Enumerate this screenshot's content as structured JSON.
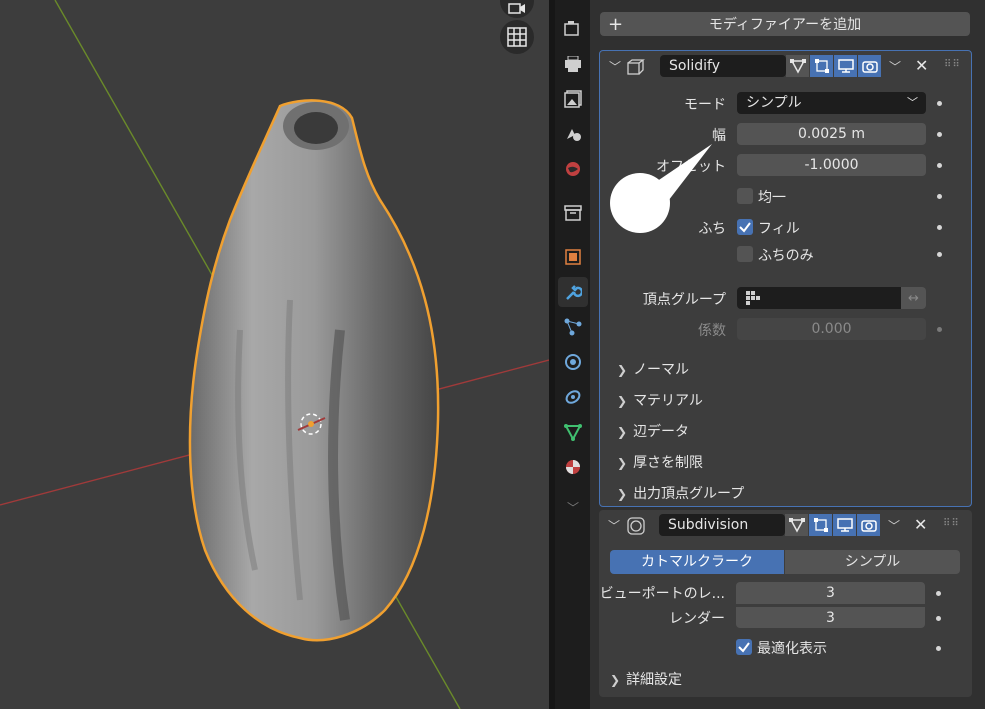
{
  "properties": {
    "add_modifier_label": "モディファイアーを追加",
    "solidify": {
      "name": "Solidify",
      "mode_label": "モード",
      "mode_value": "シンプル",
      "width_label": "幅",
      "width_value": "0.0025 m",
      "offset_label": "オフセット",
      "offset_value": "-1.0000",
      "even_label": "均一",
      "rim_label": "ふち",
      "fill_label": "フィル",
      "rim_only_label": "ふちのみ",
      "vertex_group_label": "頂点グループ",
      "factor_label": "係数",
      "factor_value": "0.000",
      "subpanels": [
        "ノーマル",
        "マテリアル",
        "辺データ",
        "厚さを制限",
        "出力頂点グループ"
      ]
    },
    "subdivision": {
      "name": "Subdivision",
      "type_catmull": "カトマルクラーク",
      "type_simple": "シンプル",
      "viewport_label": "ビューポートのレ...",
      "viewport_value": "3",
      "render_label": "レンダー",
      "render_value": "3",
      "optimal_label": "最適化表示",
      "advanced_label": "詳細設定"
    }
  },
  "colors": {
    "accent": "#4772b3",
    "selection_outline": "#f0a030",
    "x_axis": "#a03a3a",
    "y_axis": "#6a8a2a"
  },
  "icons": [
    "camera-icon",
    "grid-icon",
    "wrench-icon",
    "filter-icon",
    "close-icon"
  ]
}
